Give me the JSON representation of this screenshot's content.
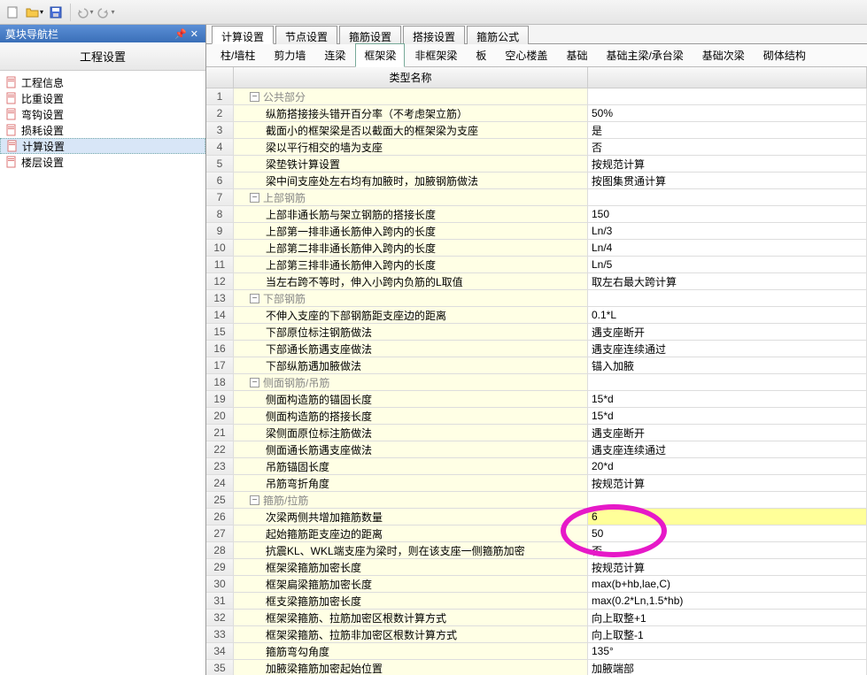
{
  "sidebar": {
    "title": "莫块导航栏",
    "heading": "工程设置",
    "items": [
      {
        "label": "工程信息",
        "icon": "doc"
      },
      {
        "label": "比重设置",
        "icon": "doc"
      },
      {
        "label": "弯钩设置",
        "icon": "doc"
      },
      {
        "label": "损耗设置",
        "icon": "doc"
      },
      {
        "label": "计算设置",
        "icon": "doc",
        "selected": true
      },
      {
        "label": "楼层设置",
        "icon": "doc"
      }
    ]
  },
  "tabs1": [
    {
      "label": "计算设置",
      "active": true
    },
    {
      "label": "节点设置"
    },
    {
      "label": "箍筋设置"
    },
    {
      "label": "搭接设置"
    },
    {
      "label": "箍筋公式"
    }
  ],
  "tabs2": [
    {
      "label": "柱/墙柱"
    },
    {
      "label": "剪力墙"
    },
    {
      "label": "连梁"
    },
    {
      "label": "框架梁",
      "active": true
    },
    {
      "label": "非框架梁"
    },
    {
      "label": "板"
    },
    {
      "label": "空心楼盖"
    },
    {
      "label": "基础"
    },
    {
      "label": "基础主梁/承台梁"
    },
    {
      "label": "基础次梁"
    },
    {
      "label": "砌体结构"
    }
  ],
  "grid": {
    "header_name": "类型名称",
    "header_value": "",
    "rows": [
      {
        "n": 1,
        "type": "group",
        "name": "公共部分",
        "val": ""
      },
      {
        "n": 2,
        "type": "item",
        "name": "纵筋搭接接头错开百分率（不考虑架立筋）",
        "val": "50%"
      },
      {
        "n": 3,
        "type": "item",
        "name": "截面小的框架梁是否以截面大的框架梁为支座",
        "val": "是"
      },
      {
        "n": 4,
        "type": "item",
        "name": "梁以平行相交的墙为支座",
        "val": "否"
      },
      {
        "n": 5,
        "type": "item",
        "name": "梁垫铁计算设置",
        "val": "按规范计算"
      },
      {
        "n": 6,
        "type": "item",
        "name": "梁中间支座处左右均有加腋时，加腋钢筋做法",
        "val": "按图集贯通计算"
      },
      {
        "n": 7,
        "type": "group",
        "name": "上部钢筋",
        "val": ""
      },
      {
        "n": 8,
        "type": "item",
        "name": "上部非通长筋与架立钢筋的搭接长度",
        "val": "150"
      },
      {
        "n": 9,
        "type": "item",
        "name": "上部第一排非通长筋伸入跨内的长度",
        "val": "Ln/3"
      },
      {
        "n": 10,
        "type": "item",
        "name": "上部第二排非通长筋伸入跨内的长度",
        "val": "Ln/4"
      },
      {
        "n": 11,
        "type": "item",
        "name": "上部第三排非通长筋伸入跨内的长度",
        "val": "Ln/5"
      },
      {
        "n": 12,
        "type": "item",
        "name": "当左右跨不等时，伸入小跨内负筋的L取值",
        "val": "取左右最大跨计算"
      },
      {
        "n": 13,
        "type": "group",
        "name": "下部钢筋",
        "val": ""
      },
      {
        "n": 14,
        "type": "item",
        "name": "不伸入支座的下部钢筋距支座边的距离",
        "val": "0.1*L"
      },
      {
        "n": 15,
        "type": "item",
        "name": "下部原位标注钢筋做法",
        "val": "遇支座断开"
      },
      {
        "n": 16,
        "type": "item",
        "name": "下部通长筋遇支座做法",
        "val": "遇支座连续通过"
      },
      {
        "n": 17,
        "type": "item",
        "name": "下部纵筋遇加腋做法",
        "val": "锚入加腋"
      },
      {
        "n": 18,
        "type": "group",
        "name": "侧面钢筋/吊筋",
        "val": ""
      },
      {
        "n": 19,
        "type": "item",
        "name": "侧面构造筋的锚固长度",
        "val": "15*d"
      },
      {
        "n": 20,
        "type": "item",
        "name": "侧面构造筋的搭接长度",
        "val": "15*d"
      },
      {
        "n": 21,
        "type": "item",
        "name": "梁侧面原位标注筋做法",
        "val": "遇支座断开"
      },
      {
        "n": 22,
        "type": "item",
        "name": "侧面通长筋遇支座做法",
        "val": "遇支座连续通过"
      },
      {
        "n": 23,
        "type": "item",
        "name": "吊筋锚固长度",
        "val": "20*d"
      },
      {
        "n": 24,
        "type": "item",
        "name": "吊筋弯折角度",
        "val": "按规范计算"
      },
      {
        "n": 25,
        "type": "group",
        "name": "箍筋/拉筋",
        "val": ""
      },
      {
        "n": 26,
        "type": "item",
        "name": "次梁两侧共增加箍筋数量",
        "val": "6",
        "highlight": true
      },
      {
        "n": 27,
        "type": "item",
        "name": "起始箍筋距支座边的距离",
        "val": "50"
      },
      {
        "n": 28,
        "type": "item",
        "name": "抗震KL、WKL端支座为梁时，则在该支座一侧箍筋加密",
        "val": "否"
      },
      {
        "n": 29,
        "type": "item",
        "name": "框架梁箍筋加密长度",
        "val": "按规范计算"
      },
      {
        "n": 30,
        "type": "item",
        "name": "框架扁梁箍筋加密长度",
        "val": "max(b+hb,lae,C)"
      },
      {
        "n": 31,
        "type": "item",
        "name": "框支梁箍筋加密长度",
        "val": "max(0.2*Ln,1.5*hb)"
      },
      {
        "n": 32,
        "type": "item",
        "name": "框架梁箍筋、拉筋加密区根数计算方式",
        "val": "向上取整+1"
      },
      {
        "n": 33,
        "type": "item",
        "name": "框架梁箍筋、拉筋非加密区根数计算方式",
        "val": "向上取整-1"
      },
      {
        "n": 34,
        "type": "item",
        "name": "箍筋弯勾角度",
        "val": "135°"
      },
      {
        "n": 35,
        "type": "item",
        "name": "加腋梁箍筋加密起始位置",
        "val": "加腋端部"
      }
    ]
  }
}
